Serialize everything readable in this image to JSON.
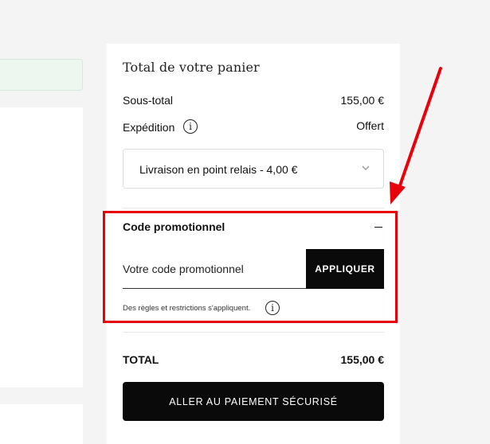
{
  "summary": {
    "title": "Total de votre panier",
    "subtotal_label": "Sous-total",
    "subtotal_value": "155,00 €",
    "shipping_label": "Expédition",
    "shipping_value": "Offert",
    "shipping_select_value": "Livraison en point relais - 4,00 €"
  },
  "promo": {
    "title": "Code promotionnel",
    "input_placeholder": "Votre code promotionnel",
    "input_value": "",
    "apply_label": "APPLIQUER",
    "note": "Des règles et restrictions s'appliquent."
  },
  "total": {
    "label": "TOTAL",
    "value": "155,00 €"
  },
  "checkout": {
    "label": "ALLER AU PAIEMENT SÉCURISÉ"
  },
  "icons": {
    "info": "info-icon",
    "chevron": "chevron-down-icon",
    "collapse": "minus-icon"
  },
  "colors": {
    "annotation": "#e8000b",
    "button_bg": "#0a0a0a",
    "page_bg": "#f4f4f4"
  }
}
